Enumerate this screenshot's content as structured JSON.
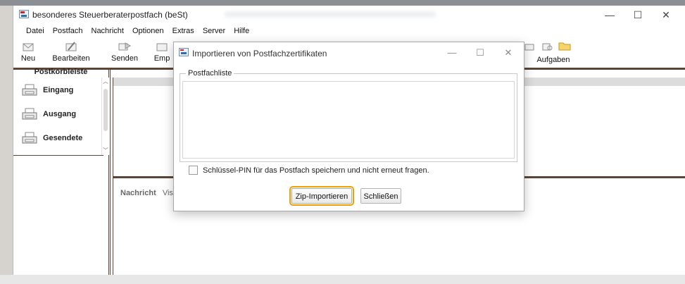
{
  "window": {
    "title": "besonderes Steuerberaterpostfach (beSt)",
    "controls": [
      "—",
      "☐",
      "✕"
    ]
  },
  "menu": [
    "Datei",
    "Postfach",
    "Nachricht",
    "Optionen",
    "Extras",
    "Server",
    "Hilfe"
  ],
  "toolbar": {
    "buttons": [
      {
        "label": "Neu",
        "icon": "new-mail-icon"
      },
      {
        "label": "Bearbeiten",
        "icon": "edit-mail-icon"
      },
      {
        "label": "Senden",
        "icon": "send-mail-icon"
      },
      {
        "label": "Emp",
        "icon": "receive-mail-icon"
      },
      {
        "label": "Aufgaben",
        "icon": "tasks-icon"
      }
    ]
  },
  "sidebar": {
    "title": "Postkorbleiste",
    "items": [
      {
        "label": "Eingang",
        "icon": "inbox-printer-icon"
      },
      {
        "label": "Ausgang",
        "icon": "outbox-printer-icon"
      },
      {
        "label": "Gesendete",
        "icon": "sent-printer-icon"
      }
    ]
  },
  "preview": {
    "tab": "Nachricht",
    "tab2": "Vis"
  },
  "dialog": {
    "title": "Importieren von Postfachzertifikaten",
    "group_label": "Postfachliste",
    "checkbox_label": "Schlüssel-PIN für das Postfach speichern und nicht erneut fragen.",
    "checkbox_checked": false,
    "import_button": "Zip-Importieren",
    "close_button": "Schließen",
    "controls": [
      "—",
      "☐",
      "✕"
    ]
  }
}
